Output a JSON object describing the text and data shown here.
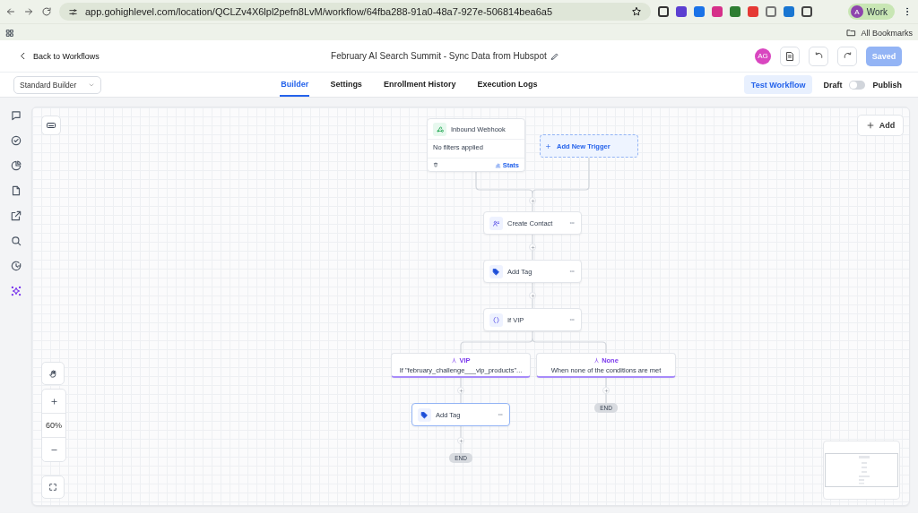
{
  "browser": {
    "url": "app.gohighlevel.com/location/QCLZv4X6lpl2pefn8LvM/workflow/64fba288-91a0-48a7-927e-506814bea6a5",
    "profile_initial": "A",
    "profile_name": "Work",
    "bookmarks": "All Bookmarks"
  },
  "header": {
    "back": "Back to Workflows",
    "title": "February AI Search Summit - Sync Data from Hubspot",
    "avatar": "AG",
    "save": "Saved"
  },
  "toolbar": {
    "builder_select": "Standard Builder",
    "test": "Test Workflow",
    "draft": "Draft",
    "publish": "Publish",
    "published": false
  },
  "tabs": [
    {
      "label": "Builder",
      "selected": true
    },
    {
      "label": "Settings",
      "selected": false
    },
    {
      "label": "Enrollment History",
      "selected": false
    },
    {
      "label": "Execution Logs",
      "selected": false
    }
  ],
  "sidebar": {
    "items": [
      {
        "kind": "chat",
        "selected": false
      },
      {
        "kind": "check",
        "selected": false
      },
      {
        "kind": "pie",
        "selected": false
      },
      {
        "kind": "note",
        "selected": false
      },
      {
        "kind": "external",
        "selected": false
      },
      {
        "kind": "search",
        "selected": false
      },
      {
        "kind": "history",
        "selected": false
      },
      {
        "kind": "ai",
        "selected": true
      }
    ]
  },
  "canvas": {
    "add": "Add",
    "zoom": "60%",
    "trigger": {
      "title": "Inbound Webhook",
      "filters": "No filters applied",
      "stats": "Stats"
    },
    "add_trigger": "Add New Trigger",
    "steps": [
      {
        "kind": "contact",
        "label": "Create Contact",
        "selected": false
      },
      {
        "kind": "tag",
        "label": "Add Tag",
        "selected": false
      },
      {
        "kind": "condition",
        "label": "If VIP",
        "selected": false
      }
    ],
    "branches": [
      {
        "name": "VIP",
        "condition": "If \"february_challenge___vip_products\"...",
        "steps": [
          {
            "kind": "tag",
            "label": "Add Tag",
            "selected": true
          }
        ],
        "end": "END"
      },
      {
        "name": "None",
        "condition": "When none of the conditions are met",
        "end": "END"
      }
    ]
  }
}
